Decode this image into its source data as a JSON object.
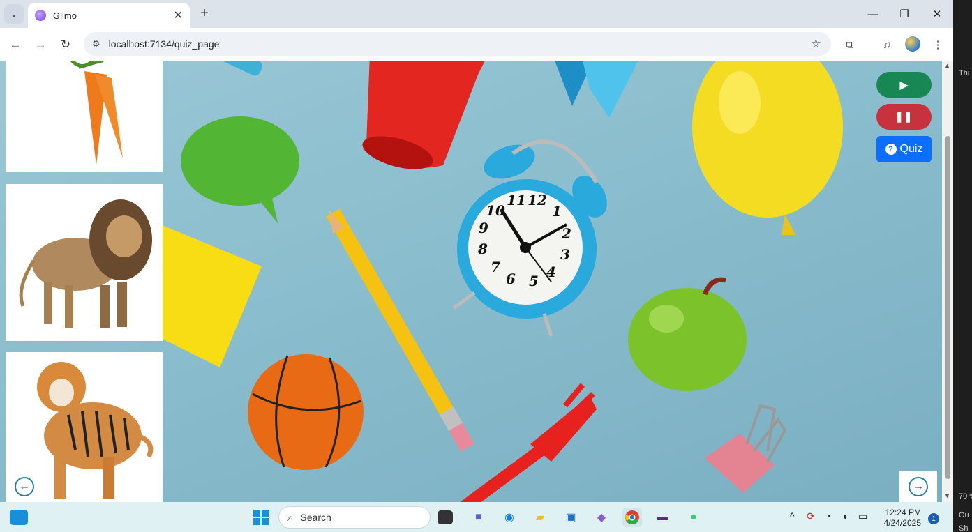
{
  "browser": {
    "tab_title": "Glimo",
    "url": "localhost:7134/quiz_page",
    "new_tab_label": "+",
    "minimize": "—",
    "maximize": "❐",
    "close": "✕"
  },
  "toolbar_icons": {
    "back": "←",
    "forward": "→",
    "reload": "↻",
    "site_info": "⚙",
    "bookmark": "☆",
    "extensions": "⧉",
    "media": "♫",
    "menu": "⋮"
  },
  "sidebar": {
    "cards": [
      {
        "name": "carrot"
      },
      {
        "name": "lion"
      },
      {
        "name": "tiger"
      }
    ]
  },
  "controls": {
    "play_icon": "▶",
    "pause_icon": "❚❚",
    "quiz_label": "Quiz",
    "quiz_icon": "?",
    "prev_icon": "←",
    "next_icon": "→"
  },
  "clock_face": {
    "numbers": [
      "12",
      "1",
      "2",
      "3",
      "4",
      "5",
      "6",
      "7",
      "8",
      "9",
      "10",
      "11"
    ]
  },
  "taskbar": {
    "search_placeholder": "Search",
    "time": "12:24 PM",
    "date": "4/24/2025",
    "notification_count": "1"
  },
  "right_strip": {
    "texts": [
      "Thi",
      "70 %",
      "Ou",
      "Sh"
    ]
  },
  "colors": {
    "play": "#198754",
    "pause": "#c8323f",
    "quiz": "#0d6efd",
    "background": "#88bccc"
  }
}
